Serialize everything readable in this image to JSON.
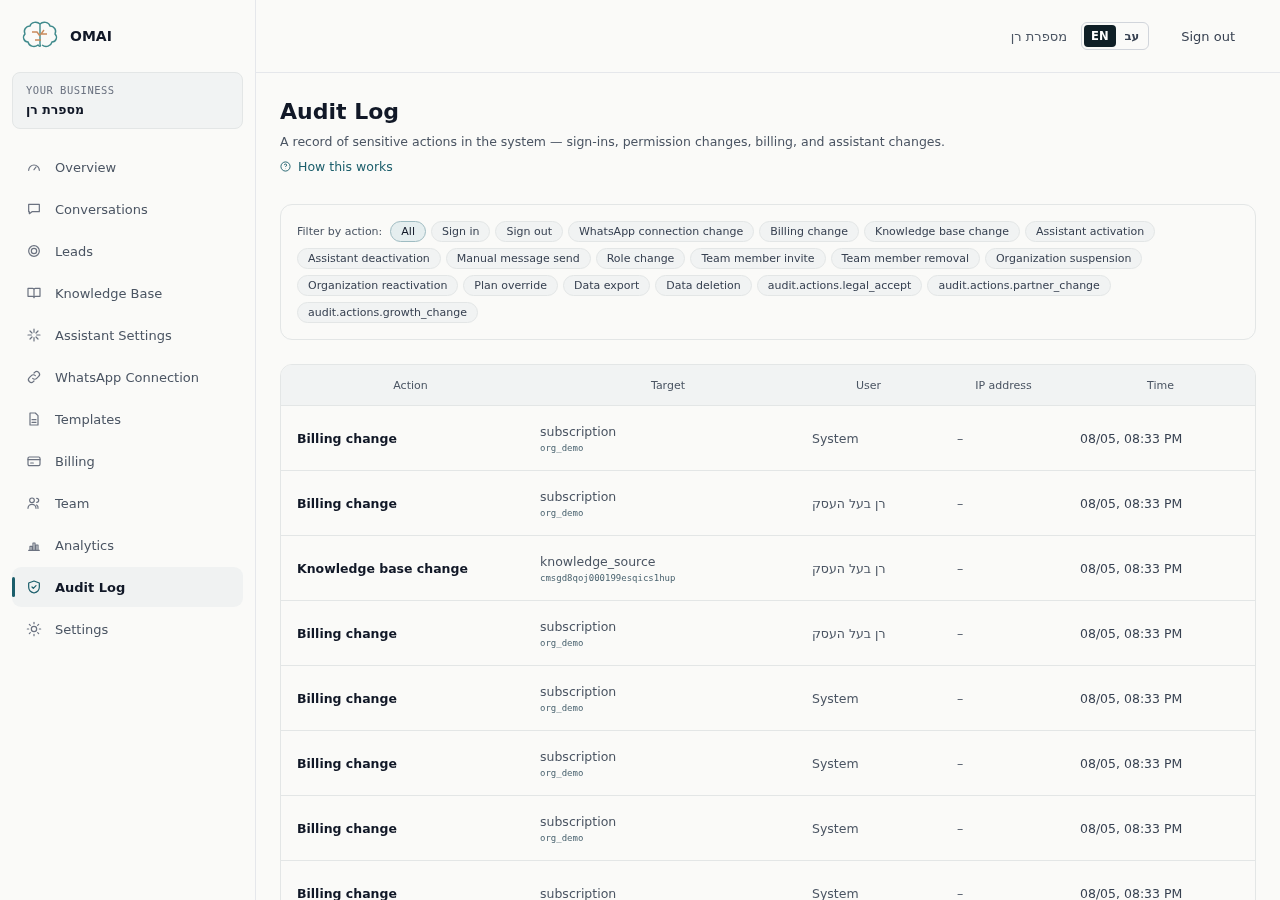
{
  "brand": {
    "name": "OMAI"
  },
  "business": {
    "label": "YOUR BUSINESS",
    "name": "מספרת רן"
  },
  "sidebar": {
    "items": [
      {
        "label": "Overview",
        "selected": false
      },
      {
        "label": "Conversations",
        "selected": false
      },
      {
        "label": "Leads",
        "selected": false
      },
      {
        "label": "Knowledge Base",
        "selected": false
      },
      {
        "label": "Assistant Settings",
        "selected": false
      },
      {
        "label": "WhatsApp Connection",
        "selected": false
      },
      {
        "label": "Templates",
        "selected": false
      },
      {
        "label": "Billing",
        "selected": false
      },
      {
        "label": "Team",
        "selected": false
      },
      {
        "label": "Analytics",
        "selected": false
      },
      {
        "label": "Audit Log",
        "selected": true
      },
      {
        "label": "Settings",
        "selected": false
      }
    ]
  },
  "header": {
    "business_name": "מספרת רן",
    "languages": [
      {
        "label": "EN",
        "selected": true
      },
      {
        "label": "עב",
        "selected": false
      }
    ],
    "sign_out": "Sign out"
  },
  "page": {
    "title": "Audit Log",
    "description": "A record of sensitive actions in the system — sign-ins, permission changes, billing, and assistant changes.",
    "help_link": "How this works"
  },
  "filter": {
    "label": "Filter by action:",
    "chips": [
      {
        "label": "All",
        "selected": true
      },
      {
        "label": "Sign in",
        "selected": false
      },
      {
        "label": "Sign out",
        "selected": false
      },
      {
        "label": "WhatsApp connection change",
        "selected": false
      },
      {
        "label": "Billing change",
        "selected": false
      },
      {
        "label": "Knowledge base change",
        "selected": false
      },
      {
        "label": "Assistant activation",
        "selected": false
      },
      {
        "label": "Assistant deactivation",
        "selected": false
      },
      {
        "label": "Manual message send",
        "selected": false
      },
      {
        "label": "Role change",
        "selected": false
      },
      {
        "label": "Team member invite",
        "selected": false
      },
      {
        "label": "Team member removal",
        "selected": false
      },
      {
        "label": "Organization suspension",
        "selected": false
      },
      {
        "label": "Organization reactivation",
        "selected": false
      },
      {
        "label": "Plan override",
        "selected": false
      },
      {
        "label": "Data export",
        "selected": false
      },
      {
        "label": "Data deletion",
        "selected": false
      },
      {
        "label": "audit.actions.legal_accept",
        "selected": false
      },
      {
        "label": "audit.actions.partner_change",
        "selected": false
      },
      {
        "label": "audit.actions.growth_change",
        "selected": false
      }
    ]
  },
  "table": {
    "columns": [
      "Action",
      "Target",
      "User",
      "IP address",
      "Time"
    ],
    "rows": [
      {
        "action": "Billing change",
        "target": "subscription",
        "target_id": "org_demo",
        "user": "System",
        "ip": "–",
        "time": "08/05, 08:33 PM"
      },
      {
        "action": "Billing change",
        "target": "subscription",
        "target_id": "org_demo",
        "user": "רן בעל העסק",
        "ip": "–",
        "time": "08/05, 08:33 PM"
      },
      {
        "action": "Knowledge base change",
        "target": "knowledge_source",
        "target_id": "cmsgd8qoj000199esqics1hup",
        "user": "רן בעל העסק",
        "ip": "–",
        "time": "08/05, 08:33 PM"
      },
      {
        "action": "Billing change",
        "target": "subscription",
        "target_id": "org_demo",
        "user": "רן בעל העסק",
        "ip": "–",
        "time": "08/05, 08:33 PM"
      },
      {
        "action": "Billing change",
        "target": "subscription",
        "target_id": "org_demo",
        "user": "System",
        "ip": "–",
        "time": "08/05, 08:33 PM"
      },
      {
        "action": "Billing change",
        "target": "subscription",
        "target_id": "org_demo",
        "user": "System",
        "ip": "–",
        "time": "08/05, 08:33 PM"
      },
      {
        "action": "Billing change",
        "target": "subscription",
        "target_id": "org_demo",
        "user": "System",
        "ip": "–",
        "time": "08/05, 08:33 PM"
      },
      {
        "action": "Billing change",
        "target": "subscription",
        "user": "System",
        "ip": "–",
        "time": "08/05, 08:33 PM"
      }
    ]
  }
}
